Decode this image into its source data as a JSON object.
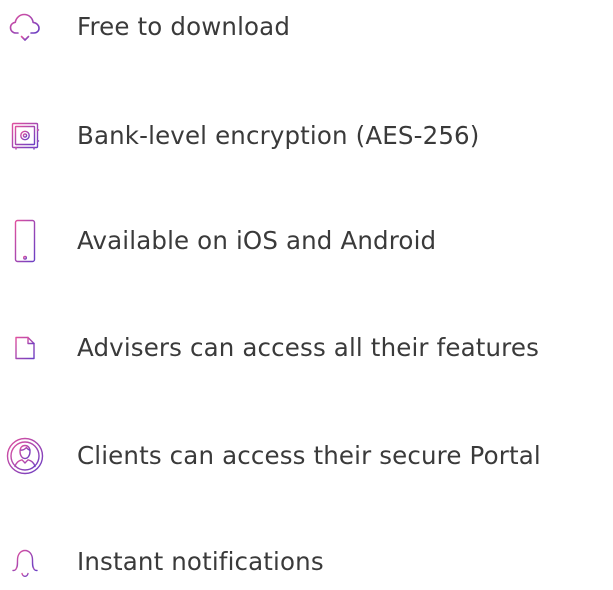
{
  "colors": {
    "icon_gradient_start": "#e0509e",
    "icon_gradient_end": "#6a3fc4",
    "text": "#3a3a3a",
    "background": "#ffffff"
  },
  "features": [
    {
      "icon": "cloud-download-icon",
      "label": "Free to download"
    },
    {
      "icon": "safe-icon",
      "label": "Bank-level encryption (AES-256)"
    },
    {
      "icon": "smartphone-icon",
      "label": "Available on iOS and Android"
    },
    {
      "icon": "document-icon",
      "label": "Advisers can access all their features"
    },
    {
      "icon": "user-circle-icon",
      "label": "Clients can access their secure Portal"
    },
    {
      "icon": "bell-icon",
      "label": "Instant notifications"
    }
  ]
}
